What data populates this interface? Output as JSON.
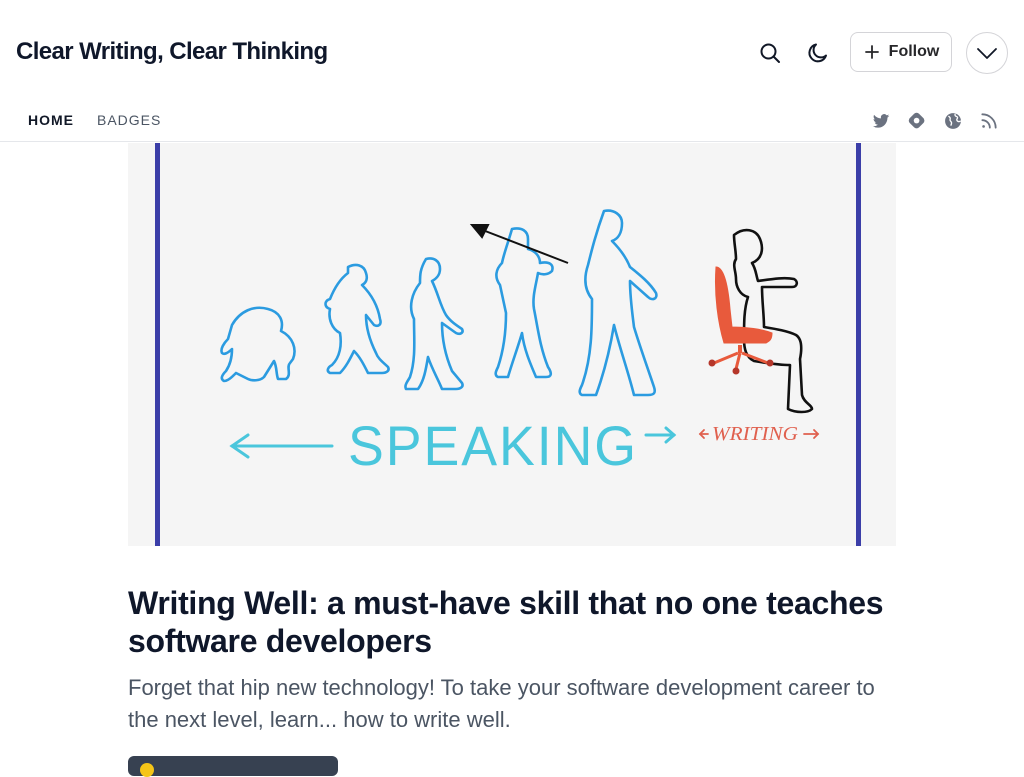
{
  "header": {
    "site_title": "Clear Writing, Clear Thinking",
    "follow_label": "Follow",
    "icons": [
      "search-icon",
      "moon-icon",
      "plus-icon",
      "chevron-down-icon"
    ]
  },
  "nav": {
    "tabs": [
      {
        "label": "HOME",
        "active": true
      },
      {
        "label": "BADGES",
        "active": false
      }
    ],
    "social_icons": [
      "twitter-icon",
      "hashnode-icon",
      "globe-icon",
      "rss-icon"
    ]
  },
  "cover_image": {
    "speaking_text": "SPEAKING",
    "writing_text": "WRITING",
    "colors": {
      "frame": "#3b3ea8",
      "figures": "#2b9be0",
      "speaking": "#4ac6dc",
      "writing": "#e0604e",
      "chair": "#e85a3c"
    }
  },
  "post": {
    "title": "Writing Well: a must-have skill that no one teaches software developers",
    "brief": "Forget that hip new technology! To take your software development career to the next level, learn... how to write well."
  }
}
